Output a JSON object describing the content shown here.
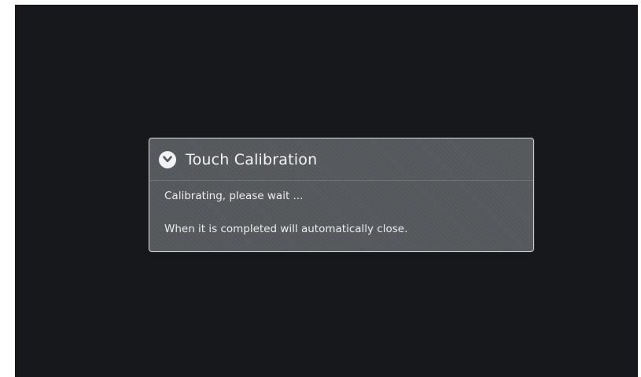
{
  "dialog": {
    "icon": "chevron-down-circle-icon",
    "title": "Touch Calibration",
    "messages": [
      "Calibrating, please wait ...",
      "When it is completed will automatically close."
    ]
  },
  "colors": {
    "screen_background": "#16181b",
    "dialog_background": "#55585c",
    "dialog_border": "#cfd0d2",
    "text": "#f4f4f4"
  }
}
